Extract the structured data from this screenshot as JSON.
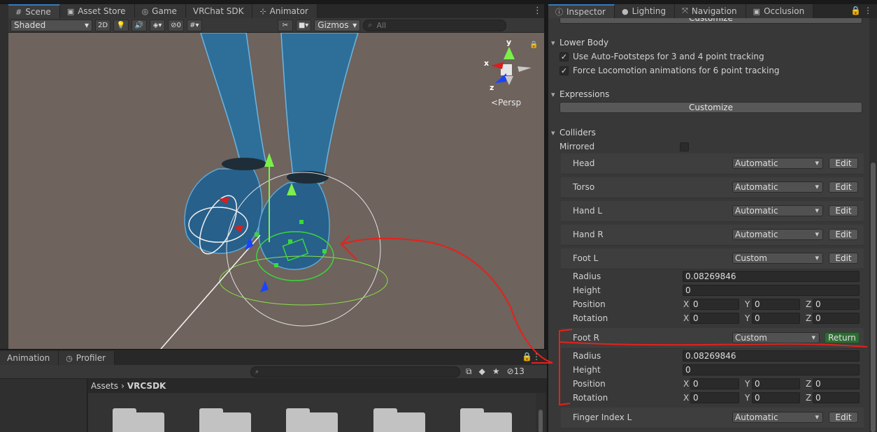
{
  "scene_tabs": [
    {
      "label": "Scene",
      "icon": "#",
      "active": true
    },
    {
      "label": "Asset Store",
      "icon": "▣"
    },
    {
      "label": "Game",
      "icon": "◎"
    },
    {
      "label": "VRChat SDK",
      "icon": ""
    },
    {
      "label": "Animator",
      "icon": "⊹"
    }
  ],
  "scene_toolbar": {
    "shading": "Shaded",
    "mode_2d": "2D",
    "hidden_count": "0",
    "gizmos": "Gizmos",
    "search_placeholder": "All"
  },
  "viewport": {
    "axis_x": "x",
    "axis_y": "y",
    "axis_z": "z",
    "projection": "Persp"
  },
  "bottom_tabs": [
    {
      "label": "Animation",
      "icon": ""
    },
    {
      "label": "Profiler",
      "icon": "◷"
    }
  ],
  "project": {
    "hidden_count": "13",
    "breadcrumb_root": "Assets",
    "breadcrumb_current": "VRCSDK"
  },
  "inspector_tabs": [
    {
      "label": "Inspector",
      "icon": "ⓘ",
      "active": true
    },
    {
      "label": "Lighting",
      "icon": "●"
    },
    {
      "label": "Navigation",
      "icon": "⤧"
    },
    {
      "label": "Occlusion",
      "icon": "▣"
    }
  ],
  "inspector": {
    "top_button": "Customize",
    "lower_body": {
      "title": "Lower Body",
      "opt1": "Use Auto-Footsteps for 3 and 4 point tracking",
      "opt2": "Force Locomotion animations for 6 point tracking"
    },
    "expressions": {
      "title": "Expressions",
      "button": "Customize"
    },
    "colliders": {
      "title": "Colliders",
      "mirrored": "Mirrored",
      "edit": "Edit",
      "return": "Return",
      "radius_label": "Radius",
      "height_label": "Height",
      "position_label": "Position",
      "rotation_label": "Rotation",
      "x": "X",
      "y": "Y",
      "z": "Z",
      "head": {
        "label": "Head",
        "mode": "Automatic"
      },
      "torso": {
        "label": "Torso",
        "mode": "Automatic"
      },
      "hand_l": {
        "label": "Hand L",
        "mode": "Automatic"
      },
      "hand_r": {
        "label": "Hand R",
        "mode": "Automatic"
      },
      "foot_l": {
        "label": "Foot L",
        "mode": "Custom",
        "radius": "0.08269846",
        "height": "0",
        "pos_x": "0",
        "pos_y": "0",
        "pos_z": "0",
        "rot_x": "0",
        "rot_y": "0",
        "rot_z": "0"
      },
      "foot_r": {
        "label": "Foot R",
        "mode": "Custom",
        "radius": "0.08269846",
        "height": "0",
        "pos_x": "0",
        "pos_y": "0",
        "pos_z": "0",
        "rot_x": "0",
        "rot_y": "0",
        "rot_z": "0"
      },
      "finger_index_l": {
        "label": "Finger Index L",
        "mode": "Automatic"
      }
    }
  },
  "colors": {
    "annotation": "#e8201a",
    "avatar": "#2d6f98",
    "viewport_bg": "#6e635d",
    "return_button": "#2f6b34",
    "tab_accent": "#3a79bb"
  }
}
